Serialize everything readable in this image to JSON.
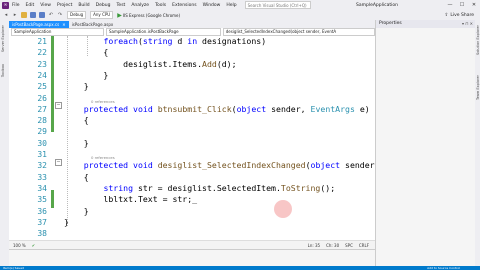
{
  "window": {
    "app_name": "SampleApplication",
    "logo_text": "∞",
    "search_placeholder": "Search Visual Studio (Ctrl+Q)",
    "minimize": "—",
    "maximize": "☐",
    "close": "✕"
  },
  "menu": [
    "File",
    "Edit",
    "View",
    "Project",
    "Build",
    "Debug",
    "Test",
    "Analyze",
    "Tools",
    "Extensions",
    "Window",
    "Help"
  ],
  "toolbar": {
    "config": "Debug",
    "platform": "Any CPU",
    "run_label": "IIS Express (Google Chrome)",
    "live_share": "Live Share"
  },
  "left_strip": {
    "tabs": [
      "Server Explorer",
      "Toolbox"
    ]
  },
  "tabs": [
    {
      "label": "isPostBackPage.aspx.cs",
      "active": true
    },
    {
      "label": "isPostBackPage.aspx",
      "active": false
    }
  ],
  "nav": {
    "project": "SampleApplication",
    "class": "SampleApplication.isPostBackPage",
    "member": "desiglist_SelectedIndexChanged(object sender, EventA"
  },
  "code": {
    "lines": [
      {
        "n": "21",
        "ref": "",
        "text": [
          {
            "t": "        "
          },
          {
            "t": "foreach",
            "c": "kw"
          },
          {
            "t": "("
          },
          {
            "t": "string",
            "c": "kw"
          },
          {
            "t": " d "
          },
          {
            "t": "in",
            "c": "kw"
          },
          {
            "t": " designations)"
          }
        ]
      },
      {
        "n": "22",
        "ref": "",
        "text": [
          {
            "t": "        {"
          }
        ]
      },
      {
        "n": "23",
        "ref": "",
        "text": [
          {
            "t": "            desiglist.Items."
          },
          {
            "t": "Add",
            "c": "me"
          },
          {
            "t": "(d);"
          }
        ]
      },
      {
        "n": "24",
        "ref": "",
        "text": [
          {
            "t": "        }"
          }
        ]
      },
      {
        "n": "25",
        "ref": "",
        "text": [
          {
            "t": "    }"
          }
        ]
      },
      {
        "n": "26",
        "ref": "",
        "text": [
          {
            "t": ""
          }
        ]
      },
      {
        "n": "27",
        "ref": "0 references",
        "text": [
          {
            "t": "    "
          },
          {
            "t": "protected",
            "c": "kw"
          },
          {
            "t": " "
          },
          {
            "t": "void",
            "c": "kw"
          },
          {
            "t": " "
          },
          {
            "t": "btnsubmit_Click",
            "c": "me"
          },
          {
            "t": "("
          },
          {
            "t": "object",
            "c": "kw"
          },
          {
            "t": " sender, "
          },
          {
            "t": "EventArgs",
            "c": "ty"
          },
          {
            "t": " e)"
          }
        ]
      },
      {
        "n": "28",
        "ref": "",
        "text": [
          {
            "t": "    {"
          }
        ]
      },
      {
        "n": "29",
        "ref": "",
        "text": [
          {
            "t": ""
          }
        ]
      },
      {
        "n": "30",
        "ref": "",
        "text": [
          {
            "t": "    }"
          }
        ]
      },
      {
        "n": "31",
        "ref": "",
        "text": [
          {
            "t": ""
          }
        ]
      },
      {
        "n": "32",
        "ref": "0 references",
        "text": [
          {
            "t": "    "
          },
          {
            "t": "protected",
            "c": "kw"
          },
          {
            "t": " "
          },
          {
            "t": "void",
            "c": "kw"
          },
          {
            "t": " "
          },
          {
            "t": "desiglist_SelectedIndexChanged",
            "c": "me"
          },
          {
            "t": "("
          },
          {
            "t": "object",
            "c": "kw"
          },
          {
            "t": " sender, "
          },
          {
            "t": "EventArg",
            "c": "ty"
          }
        ]
      },
      {
        "n": "33",
        "ref": "",
        "text": [
          {
            "t": "    {"
          }
        ]
      },
      {
        "n": "34",
        "ref": "",
        "text": [
          {
            "t": "        "
          },
          {
            "t": "string",
            "c": "kw"
          },
          {
            "t": " str = desiglist.SelectedItem."
          },
          {
            "t": "ToString",
            "c": "me"
          },
          {
            "t": "();"
          }
        ]
      },
      {
        "n": "35",
        "ref": "",
        "text": [
          {
            "t": "        lbltxt.Text = str;_"
          }
        ]
      },
      {
        "n": "36",
        "ref": "",
        "text": [
          {
            "t": "    }"
          }
        ]
      },
      {
        "n": "37",
        "ref": "",
        "text": [
          {
            "t": "}"
          }
        ]
      },
      {
        "n": "38",
        "ref": "",
        "text": [
          {
            "t": ""
          }
        ]
      }
    ]
  },
  "status_editor": {
    "zoom": "100 %",
    "position": "Ln: 35",
    "column": "Ch: 30",
    "spc": "SPC",
    "eol": "CRLF"
  },
  "right_panel": {
    "title": "Properties",
    "side_tabs": [
      "Solution Explorer",
      "Team Explorer"
    ]
  },
  "statusbar": {
    "left": "Item(s) Saved",
    "right": "Add to Source Control"
  }
}
